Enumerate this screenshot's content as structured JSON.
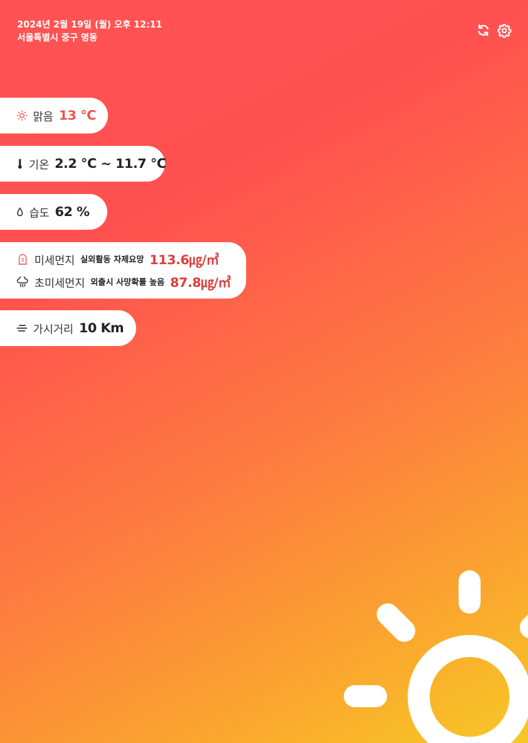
{
  "header": {
    "datetime": "2024년 2월 19일 (월) 오후 12:11",
    "location": "서울특별시 중구 명동"
  },
  "actions": {
    "refresh_icon": "refresh-icon",
    "settings_icon": "gear-icon"
  },
  "weather": {
    "condition_icon": "sun-icon",
    "condition": "맑음",
    "temperature": "13 ℃"
  },
  "temp_range": {
    "icon": "thermometer-icon",
    "label": "기온",
    "value": "2.2 ℃ ~ 11.7 ℃"
  },
  "humidity": {
    "icon": "droplet-icon",
    "label": "습도",
    "value": "62 %"
  },
  "dust": {
    "pm10": {
      "icon": "mask-icon",
      "label": "미세먼지",
      "note": "실외활동 자제요망",
      "value": "113.6㎍/㎥"
    },
    "pm25": {
      "icon": "dust-cloud-icon",
      "label": "초미세먼지",
      "note": "외출시 사망확률 높음",
      "value": "87.8㎍/㎥"
    }
  },
  "visibility": {
    "icon": "haze-icon",
    "label": "가시거리",
    "value": "10 Km"
  },
  "colors": {
    "gradient_top": "#ff5353",
    "gradient_bottom": "#f7c825",
    "accent_red": "#f2514e",
    "card_bg": "#ffffff"
  },
  "decoration": {
    "illustration": "sun-illustration"
  }
}
